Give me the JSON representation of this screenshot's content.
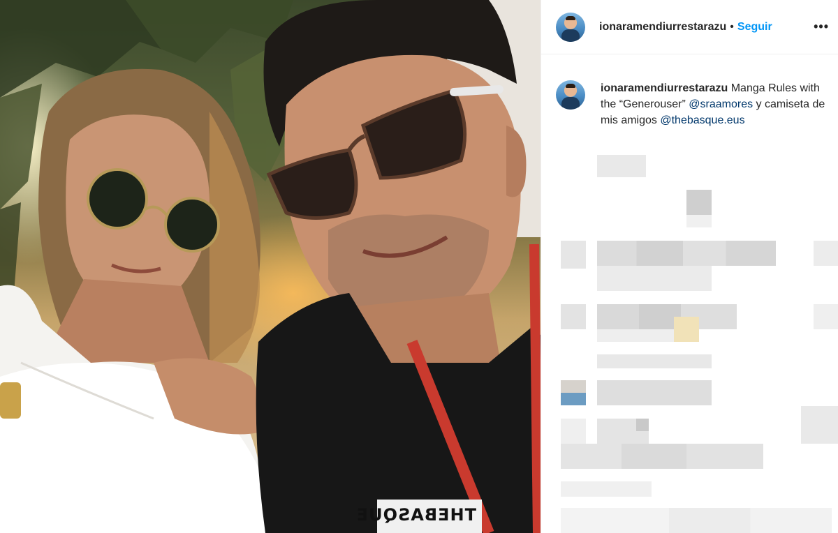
{
  "photo": {
    "shirt_print": "THEBASQUE"
  },
  "post_header": {
    "username": "ionaramendiurrestarazu",
    "separator": "•",
    "follow_label": "Seguir",
    "more_icon": "more-horizontal-icon"
  },
  "caption": {
    "username": "ionaramendiurrestarazu",
    "text_1": " Manga Rules with the “Generouser” ",
    "mention_1": "@sraamores",
    "text_2": " y camiseta de mis amigos ",
    "mention_2": "@thebasque.eus"
  },
  "colors": {
    "follow": "#0095f6",
    "mention": "#00376b",
    "text": "#262626",
    "divider": "#efefef"
  }
}
